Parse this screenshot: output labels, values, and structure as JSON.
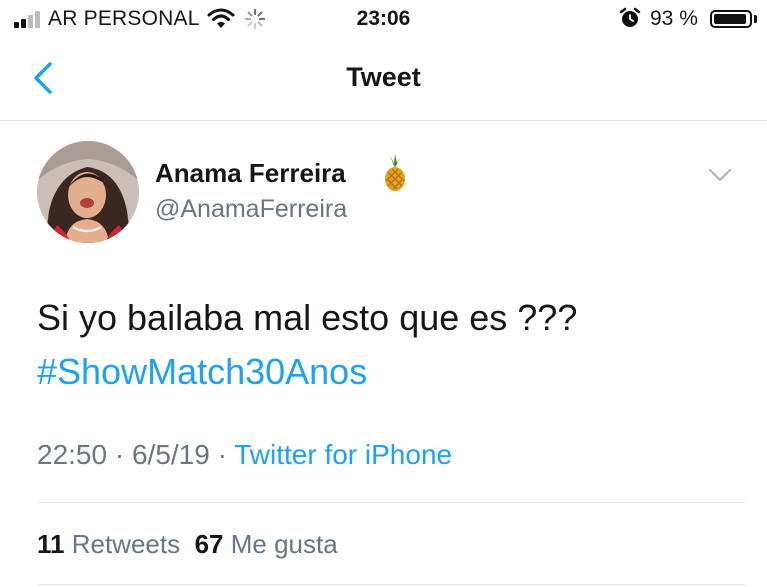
{
  "status_bar": {
    "carrier": "AR PERSONAL",
    "time": "23:06",
    "battery_percent": "93 %",
    "battery_level": 0.93,
    "icons": [
      "signal-icon",
      "wifi-icon",
      "activity-spinner-icon",
      "alarm-icon",
      "battery-icon"
    ]
  },
  "nav": {
    "title": "Tweet",
    "accent_color": "#1da1f2"
  },
  "tweet": {
    "author_name": "Anama Ferreira",
    "author_emoji": "pineapple-icon",
    "author_handle": "@AnamaFerreira",
    "text": "Si yo bailaba mal esto que es ???",
    "hashtag": "#ShowMatch30Anos",
    "time": "22:50",
    "separator_1": " · ",
    "date": "6/5/19",
    "separator_2": " · ",
    "source": "Twitter for iPhone"
  },
  "stats": {
    "retweets_count": "11",
    "retweets_label": "Retweets",
    "likes_count": "67",
    "likes_label": "Me gusta"
  }
}
